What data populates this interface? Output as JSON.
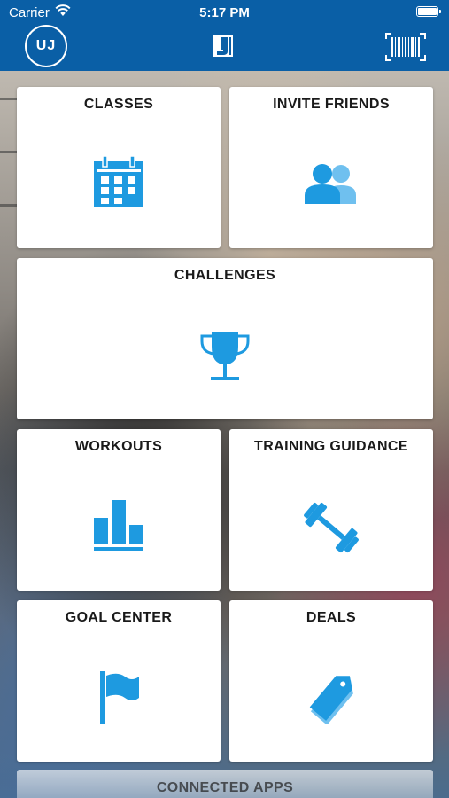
{
  "status_bar": {
    "carrier": "Carrier",
    "time": "5:17 PM"
  },
  "header": {
    "avatar_initials": "UJ",
    "logo_icon": "j-logo-icon",
    "barcode_icon": "barcode-icon",
    "color": "#0a5fa6"
  },
  "tiles": {
    "classes": {
      "label": "CLASSES",
      "icon": "calendar-icon"
    },
    "invite_friends": {
      "label": "INVITE FRIENDS",
      "icon": "people-icon"
    },
    "challenges": {
      "label": "CHALLENGES",
      "icon": "trophy-icon"
    },
    "workouts": {
      "label": "WORKOUTS",
      "icon": "bar-chart-icon"
    },
    "training_guidance": {
      "label": "TRAINING GUIDANCE",
      "icon": "dumbbell-icon"
    },
    "goal_center": {
      "label": "GOAL CENTER",
      "icon": "flag-icon"
    },
    "deals": {
      "label": "DEALS",
      "icon": "tag-icon"
    },
    "connected_apps": {
      "label": "CONNECTED APPS"
    }
  },
  "colors": {
    "icon_blue": "#1e9ae0",
    "tile_bg": "#ffffff"
  }
}
